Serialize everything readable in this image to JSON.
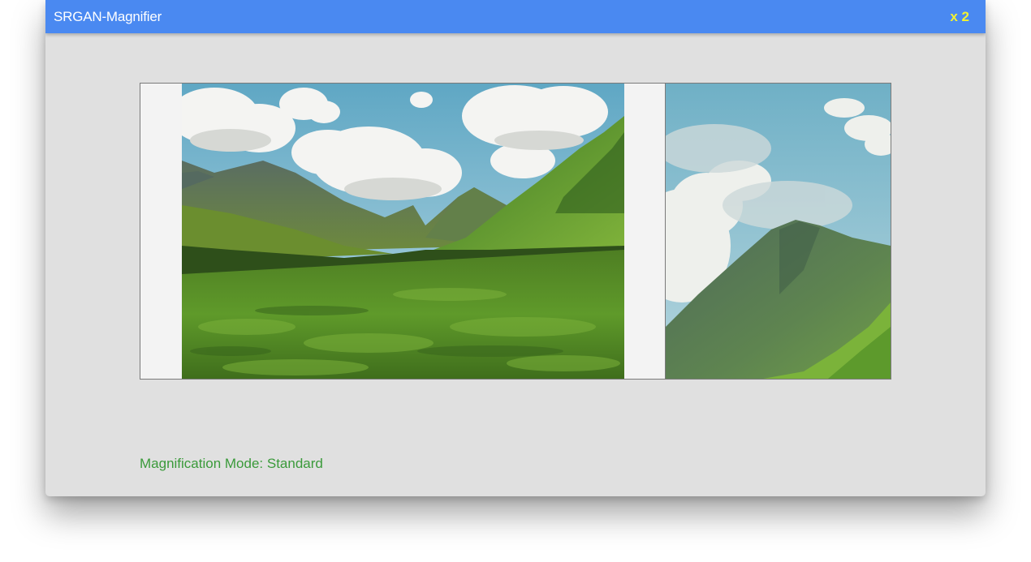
{
  "app": {
    "title": "SRGAN-Magnifier",
    "zoom_label": "x 2"
  },
  "status": {
    "mode_text": "Magnification Mode: Standard"
  },
  "colors": {
    "titlebar": "#4a89f1",
    "zoom_label": "#f2f230",
    "status_text": "#3a9a3a",
    "window_bg": "#e0e0e0"
  },
  "images": {
    "source": "mountain-valley-landscape-photo",
    "magnified": "magnified-mountain-peak-photo"
  }
}
